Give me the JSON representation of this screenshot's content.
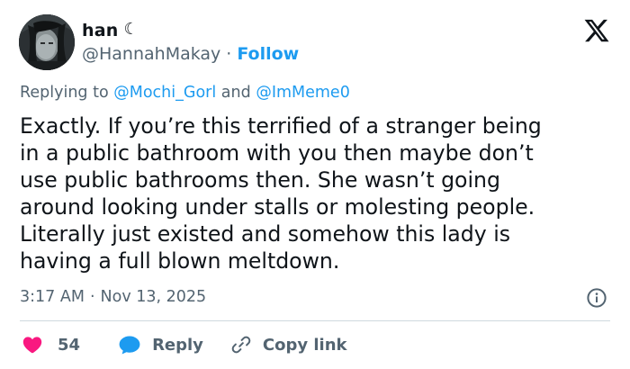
{
  "colors": {
    "accent": "#1d9bf0",
    "text_primary": "#0f1419",
    "text_secondary": "#536471",
    "like_red": "#f91880",
    "divider": "#cfd9de"
  },
  "author": {
    "display_name": "han",
    "name_emoji": "☾",
    "handle": "@HannahMakay",
    "separator": "·",
    "follow_label": "Follow",
    "avatar": "avatar-photo"
  },
  "brand_icon": "x-logo-icon",
  "replying": {
    "prefix": "Replying to",
    "mention_1": "@Mochi_Gorl",
    "conjunction": "and",
    "mention_2": "@ImMeme0"
  },
  "tweet": {
    "lines": [
      "Exactly. If you’re this terrified of a stranger being",
      "in a public bathroom with you then maybe don’t",
      "use public bathrooms then. She wasn’t going",
      "around looking under stalls or molesting people.",
      "Literally just existed and somehow this lady is",
      "having a full blown meltdown."
    ]
  },
  "meta": {
    "time": "3:17 AM",
    "separator": "·",
    "date": "Nov 13, 2025",
    "info_icon": "info-icon"
  },
  "actions": {
    "like_count": "54",
    "reply_label": "Reply",
    "copy_link_label": "Copy link"
  }
}
